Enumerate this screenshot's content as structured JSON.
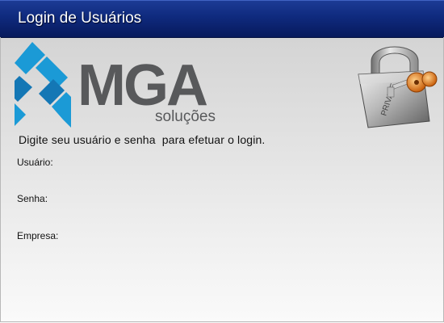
{
  "window": {
    "title": "Login de Usuários"
  },
  "brand": {
    "name": "MGA",
    "tagline": "soluções",
    "lock_text": "PRIVATE"
  },
  "form": {
    "instruction": "Digite seu usuário e senha  para efetuar o login.",
    "fields": [
      {
        "label": "Usuário:",
        "value": ""
      },
      {
        "label": "Senha:",
        "value": ""
      },
      {
        "label": "Empresa:",
        "value": ""
      }
    ]
  },
  "colors": {
    "titlebar": "#0f2a7e",
    "logo_blue": "#1b9ad6",
    "logo_gray": "#58595b",
    "lock_key": "#e07b1e"
  }
}
